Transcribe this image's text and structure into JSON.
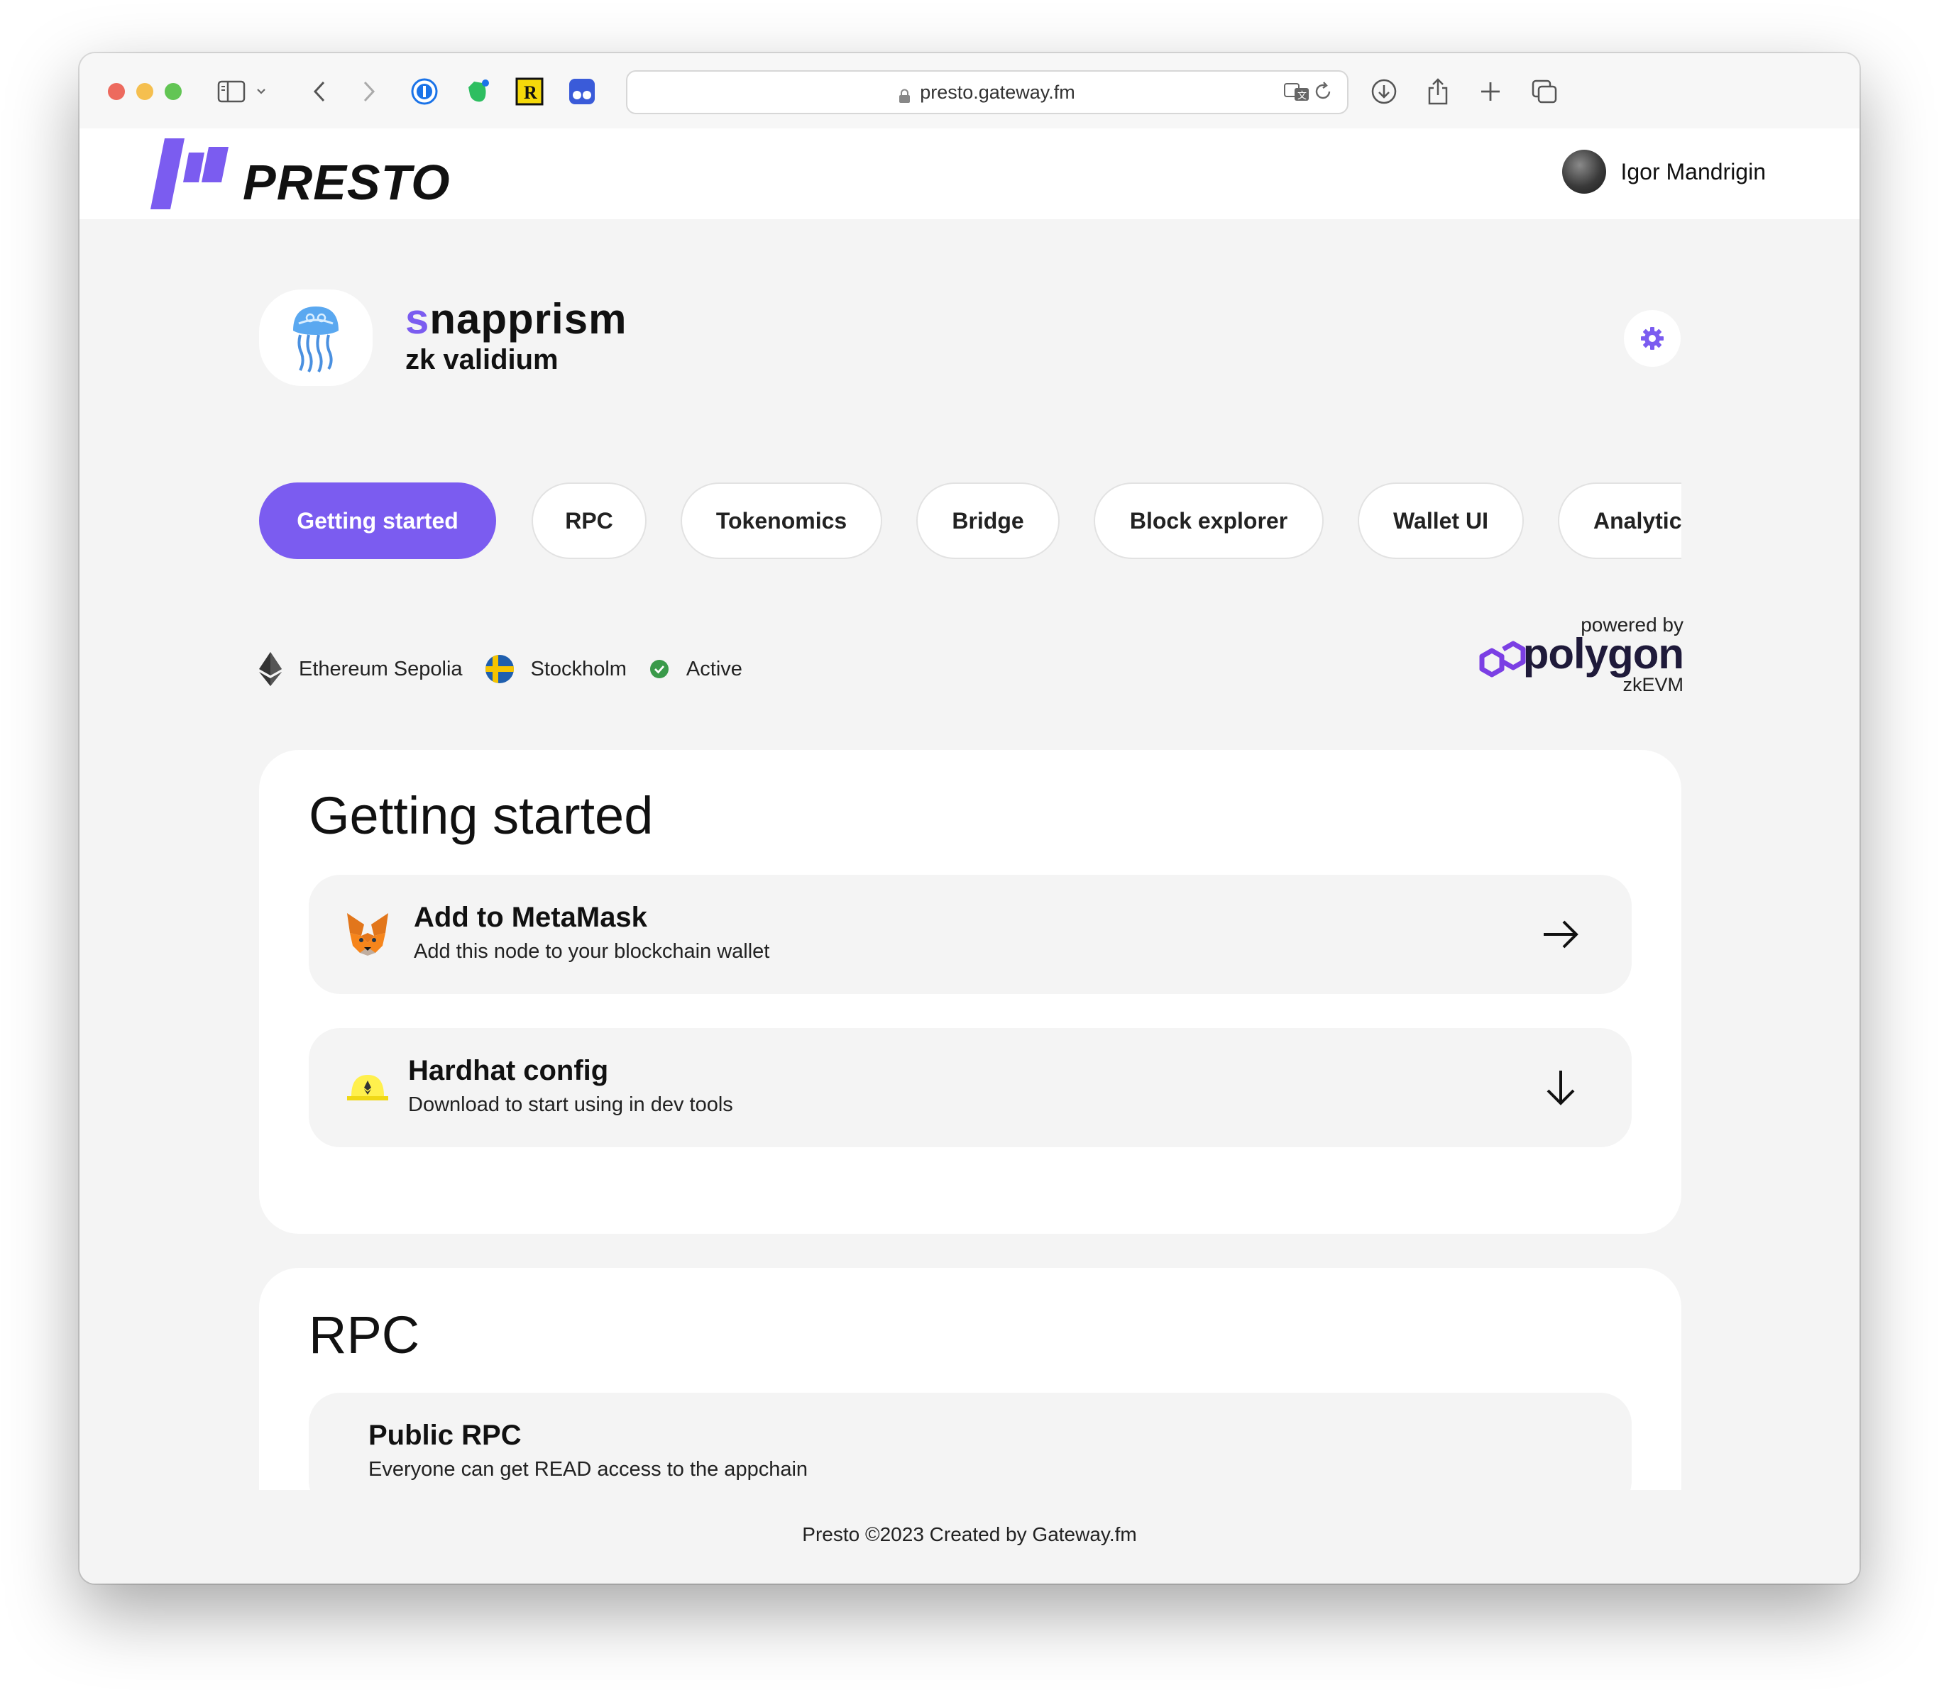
{
  "browser": {
    "url": "presto.gateway.fm"
  },
  "app": {
    "brand": "PRESTO",
    "user_name": "Igor Mandrigin"
  },
  "project": {
    "name_first": "s",
    "name_rest": "napprism",
    "type": "zk validium"
  },
  "tabs": [
    {
      "label": "Getting started",
      "active": true
    },
    {
      "label": "RPC",
      "active": false
    },
    {
      "label": "Tokenomics",
      "active": false
    },
    {
      "label": "Bridge",
      "active": false
    },
    {
      "label": "Block explorer",
      "active": false
    },
    {
      "label": "Wallet UI",
      "active": false
    },
    {
      "label": "Analytics",
      "active": false
    }
  ],
  "network": {
    "chain": "Ethereum Sepolia",
    "region": "Stockholm",
    "status": "Active"
  },
  "powered": {
    "prefix": "powered by",
    "brand": "polygon",
    "product": "zkEVM"
  },
  "getting_started": {
    "title": "Getting started",
    "items": [
      {
        "title": "Add to MetaMask",
        "subtitle": "Add this node to your blockchain wallet",
        "action": "arrow-right-icon"
      },
      {
        "title": "Hardhat config",
        "subtitle": "Download to start using in dev tools",
        "action": "arrow-down-icon"
      }
    ]
  },
  "rpc": {
    "title": "RPC",
    "items": [
      {
        "title": "Public RPC",
        "subtitle": "Everyone can get READ access to the appchain"
      }
    ]
  },
  "footer": {
    "text": "Presto ©2023 Created by Gateway.fm"
  },
  "colors": {
    "accent": "#7b5cf0",
    "status_green": "#3a9a4a",
    "polygon_purple": "#7b3fe4"
  }
}
